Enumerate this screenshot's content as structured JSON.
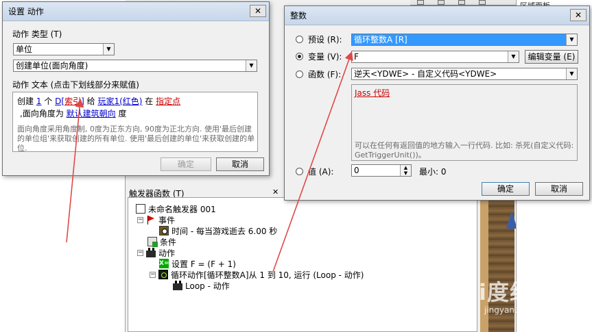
{
  "background": {
    "tree_panel_title": "触发器函数 (T)",
    "top_right_title": "区域面板",
    "watermark": "Bai度经验",
    "watermark_url": "jingyan.baidu.com",
    "trigger_tree": {
      "root": "未命名触发器 001",
      "events_label": "事件",
      "event_item": "时间 - 每当游戏逝去 6.00 秒",
      "conditions_label": "条件",
      "actions_label": "动作",
      "action_set": "设置 F = (F + 1)",
      "action_loop": "循环动作[循环整数A]从 1 到 10, 运行 (Loop - 动作)",
      "loop_child": "Loop - 动作"
    }
  },
  "action_dialog": {
    "title": "设置 动作",
    "type_label": "动作 类型 (T)",
    "type_value": "单位",
    "action_value": "创建单位(面向角度)",
    "text_label": "动作 文本 (点击下划线部分来赋值)",
    "text": {
      "t1": "创建",
      "count": "1",
      "t2": "个",
      "unit_prefix": "D[",
      "unit_index": "索引",
      "unit_suffix": "]",
      "t3": "给",
      "player": "玩家1(红色)",
      "t4": "在",
      "point": "指定点",
      "t5": ",面向角度为",
      "facing": "默认建筑朝向",
      "t6": "度"
    },
    "help_text": "面向角度采用角度制, 0度为正东方向, 90度为正北方向. 使用'最后创建的单位组'来获取创建的所有单位. 使用'最后创建的单位'来获取创建的单位.",
    "ok_label": "确定",
    "cancel_label": "取消"
  },
  "integer_dialog": {
    "title": "整数",
    "preset_label": "预设 (R):",
    "preset_value": "循环整数A [R]",
    "variable_label": "变量 (V):",
    "variable_value": "F",
    "edit_variable_label": "编辑变量 (E)",
    "function_label": "函数 (F):",
    "function_value": "逆天<YDWE> - 自定义代码<YDWE>",
    "jass_link": "Jass 代码",
    "function_help": "可以在任何有返回值的地方输入一行代码. 比如: 杀死(自定义代码: GetTriggerUnit())。",
    "value_label": "值 (A):",
    "value_value": "0",
    "min_label": "最小: 0",
    "ok_label": "确定",
    "cancel_label": "取消",
    "selected_option": "variable"
  },
  "colors": {
    "annotation_arrow": "#e04848",
    "selection": "#3399ff",
    "link_blue": "#0000cc",
    "link_red": "#cc0000"
  }
}
